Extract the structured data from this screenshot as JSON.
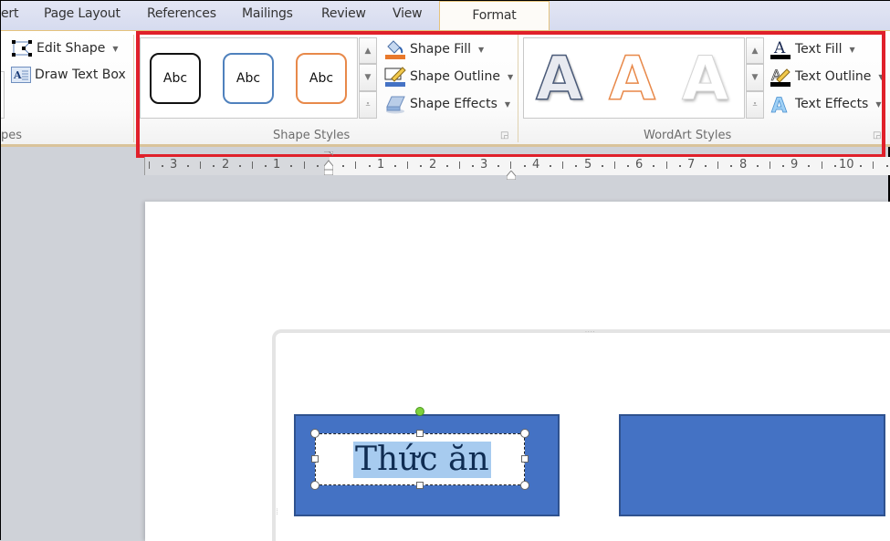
{
  "tabs": [
    {
      "label": "ert",
      "active": false
    },
    {
      "label": "Page Layout",
      "active": false
    },
    {
      "label": "References",
      "active": false
    },
    {
      "label": "Mailings",
      "active": false
    },
    {
      "label": "Review",
      "active": false
    },
    {
      "label": "View",
      "active": false
    },
    {
      "label": "Format",
      "active": true
    }
  ],
  "insert_shapes": {
    "edit_shape": "Edit Shape",
    "draw_text_box": "Draw Text Box",
    "group_label": "pes"
  },
  "shape_styles": {
    "group_label": "Shape Styles",
    "gallery": [
      {
        "label": "Abc",
        "border_color": "#111111"
      },
      {
        "label": "Abc",
        "border_color": "#4f81bd"
      },
      {
        "label": "Abc",
        "border_color": "#e8894a"
      }
    ],
    "shape_fill": "Shape Fill",
    "shape_outline": "Shape Outline",
    "shape_effects": "Shape Effects"
  },
  "wordart_styles": {
    "group_label": "WordArt Styles",
    "gallery": [
      {
        "label": "A",
        "style": "gray-outline"
      },
      {
        "label": "A",
        "style": "orange-outline"
      },
      {
        "label": "A",
        "style": "white-shadow"
      }
    ],
    "text_fill": "Text Fill",
    "text_outline": "Text Outline",
    "text_effects": "Text Effects"
  },
  "ruler": {
    "left_numbers": [
      "3",
      "2",
      "1"
    ],
    "right_numbers": [
      "1",
      "2",
      "3",
      "4",
      "5",
      "6",
      "7",
      "8",
      "9",
      "10"
    ]
  },
  "document": {
    "textbox_text": "Thức ăn"
  },
  "colors": {
    "highlight_box": "#e0202a",
    "shape_fill": "#4472c4",
    "shape_border": "#2f528f",
    "selection": "#a7cbef",
    "rotate_handle": "#7ed03c"
  }
}
